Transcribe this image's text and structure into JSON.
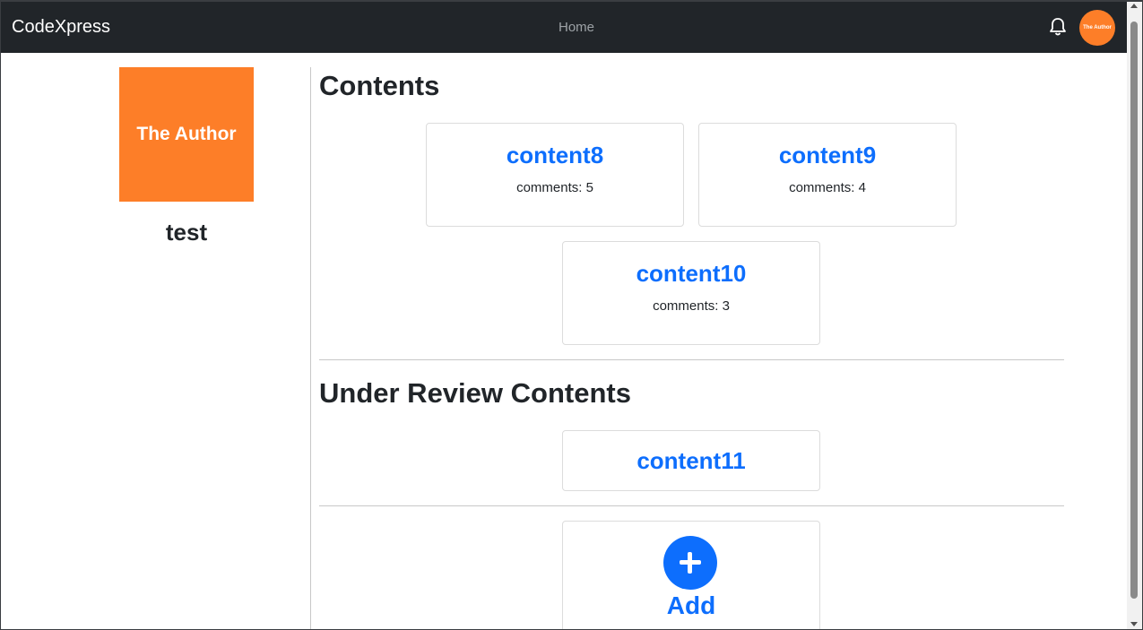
{
  "navbar": {
    "brand": "CodeXpress",
    "home_label": "Home",
    "avatar_text": "The Author"
  },
  "profile": {
    "picture_text": "The Author",
    "name": "test"
  },
  "contents": {
    "title": "Contents",
    "items": [
      {
        "title": "content8",
        "comments": "comments: 5"
      },
      {
        "title": "content9",
        "comments": "comments: 4"
      },
      {
        "title": "content10",
        "comments": "comments: 3"
      }
    ]
  },
  "under_review": {
    "title": "Under Review Contents",
    "items": [
      {
        "title": "content11"
      }
    ]
  },
  "add": {
    "label": "Add"
  },
  "colors": {
    "navbar_bg": "#212529",
    "accent": "#0d6efd",
    "author_orange": "#fd7e28"
  },
  "icons": [
    "bell-icon",
    "plus-icon"
  ]
}
